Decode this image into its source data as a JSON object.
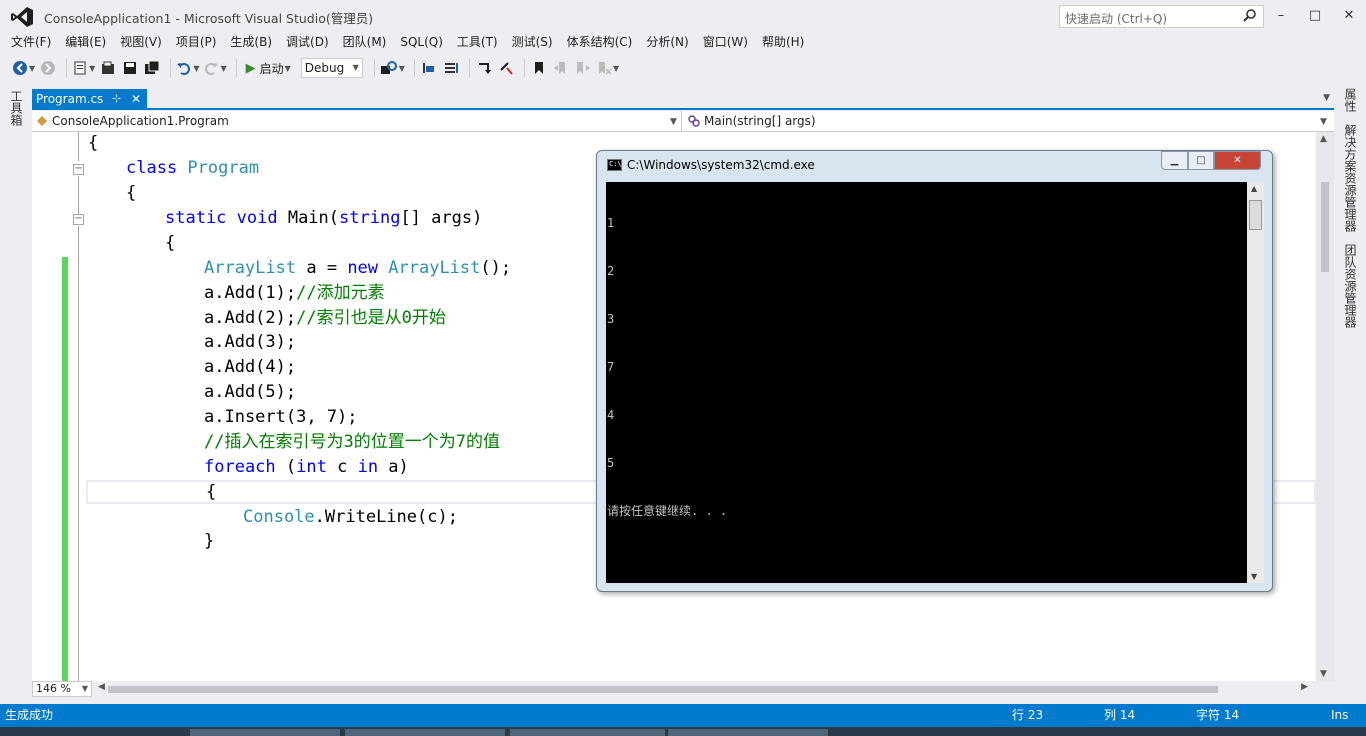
{
  "window": {
    "title": "ConsoleApplication1 - Microsoft Visual Studio(管理员)",
    "quick_launch_placeholder": "快速启动 (Ctrl+Q)",
    "minimize": "–",
    "maximize": "□",
    "close": "✕"
  },
  "menu": [
    "文件(F)",
    "编辑(E)",
    "视图(V)",
    "项目(P)",
    "生成(B)",
    "调试(D)",
    "团队(M)",
    "SQL(Q)",
    "工具(T)",
    "测试(S)",
    "体系结构(C)",
    "分析(N)",
    "窗口(W)",
    "帮助(H)"
  ],
  "toolbar": {
    "start_label": "启动",
    "configuration": "Debug"
  },
  "left_panel": {
    "toolbox_label": "工具箱"
  },
  "right_panel": {
    "properties_label": "属性",
    "solution_explorer_label": "解决方案资源管理器",
    "team_explorer_label": "团队资源管理器"
  },
  "document_tab": {
    "label": "Program.cs",
    "pin": "⊹",
    "close": "✕"
  },
  "navbar": {
    "type_label": "ConsoleApplication1.Program",
    "member_label": "Main(string[] args)"
  },
  "editor": {
    "lines": {
      "l0": "{",
      "l1_kw": "class ",
      "l1_ty": "Program",
      "l2": "{",
      "l3_kw1": "static void ",
      "l3_rest": "Main(",
      "l3_kw2": "string",
      "l3_tail": "[] args)",
      "l4": "{",
      "l5_ty1": "ArrayList",
      "l5_mid": " a = ",
      "l5_kw": "new ",
      "l5_ty2": "ArrayList",
      "l5_tail": "();",
      "l6_code": "a.Add(1);",
      "l6_cm": "//添加元素",
      "l7_code": "a.Add(2);",
      "l7_cm": "//索引也是从0开始",
      "l8": "a.Add(3);",
      "l9": "a.Add(4);",
      "l10": "a.Add(5);",
      "l11": "a.Insert(3, 7);",
      "l12_cm": "//插入在索引号为3的位置一个为7的值",
      "l13_kw1": "foreach",
      "l13_mid": " (",
      "l13_kw2": "int",
      "l13_mid2": " c ",
      "l13_kw3": "in",
      "l13_tail": " a)",
      "l14": "{",
      "l15_ty": "Console",
      "l15_tail": ".WriteLine(c);",
      "l16": "}"
    },
    "zoom": "146 %"
  },
  "console": {
    "title": "C:\\Windows\\system32\\cmd.exe",
    "output": [
      "1",
      "2",
      "3",
      "7",
      "4",
      "5",
      "请按任意键继续. . ."
    ]
  },
  "status": {
    "message": "生成成功",
    "line": "行 23",
    "col": "列 14",
    "char": "字符 14",
    "mode": "Ins"
  },
  "colors": {
    "accent": "#007acc",
    "keyword": "#0000ff",
    "type": "#2b91af",
    "comment": "#008000",
    "change_bar": "#5cd65c"
  }
}
